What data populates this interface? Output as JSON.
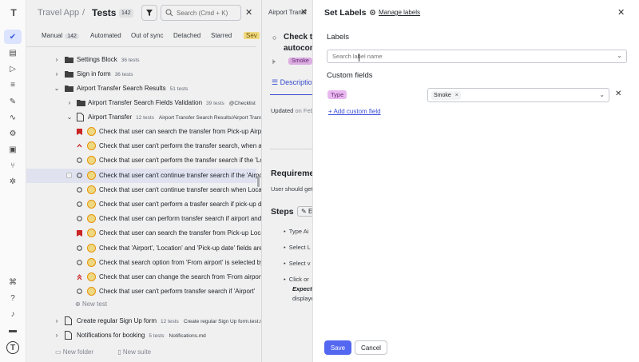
{
  "app": {
    "name": "Travel App",
    "page_title": "Tests",
    "count": "142",
    "search_placeholder": "Search (Cmd + K)"
  },
  "tabs": [
    {
      "label": "Manual",
      "count": "142"
    },
    {
      "label": "Automated"
    },
    {
      "label": "Out of sync"
    },
    {
      "label": "Detached"
    },
    {
      "label": "Starred"
    },
    {
      "label": "Sev"
    }
  ],
  "tree": {
    "settings": {
      "label": "Settings Block",
      "meta": "36 tests"
    },
    "signin": {
      "label": "Sign in form",
      "meta": "36 tests"
    },
    "airport_search": {
      "label": "Airport Transfer Search Results",
      "meta": "51 tests"
    },
    "fields_validation": {
      "label": "Airport Transfer Search Fields Validation",
      "meta": "39 tests",
      "tag": "@Checklist"
    },
    "airport_transfer": {
      "label": "Airport Transfer",
      "meta": "12 tests",
      "path": "Airport Transfer Search Results/Airport Transf"
    },
    "cases": [
      {
        "label": "Check that user can search the transfer from Pick-up Airpo",
        "priority": "high"
      },
      {
        "label": "Check that user can't perform the transfer search, when al",
        "priority": "up"
      },
      {
        "label": "Check that user can't perform the transfer search if the 'Lo",
        "priority": "none"
      },
      {
        "label": "Check that user can't continue transfer search if the 'Airpor",
        "priority": "none"
      },
      {
        "label": "Check that user can't continue transfer search when Locat",
        "priority": "none"
      },
      {
        "label": "Check that user can't perform a trasfer search if pick-up da",
        "priority": "none"
      },
      {
        "label": "Check that user can perform transfer search if airport and",
        "priority": "none"
      },
      {
        "label": "Check that user can search the transfer from Pick-up Loca",
        "priority": "high"
      },
      {
        "label": "Check that 'Airport', 'Location' and 'Pick-up date' fields are",
        "priority": "none"
      },
      {
        "label": "Check that search option from 'From airport' is selected by",
        "priority": "none"
      },
      {
        "label": "Check that user can change the search from 'From airport'",
        "priority": "upup"
      },
      {
        "label": "Check that user can't perform transfer search if 'Airport'",
        "priority": "none"
      }
    ],
    "new_test": "New test",
    "signup": {
      "label": "Create regular Sign Up form",
      "meta": "12 tests",
      "path": "Create regular Sign Up form.test.md"
    },
    "notifications": {
      "label": "Notifications for booking",
      "meta": "5 tests",
      "path": "Notifications.md"
    }
  },
  "footer": {
    "new_folder": "New folder",
    "new_suite": "New suite"
  },
  "middle": {
    "tab": "Airport Transf",
    "heading_line1": "Check th",
    "heading_line2": "autocom",
    "tag": "Smoke",
    "desc_tab": "Descriptio",
    "updated": "Updated",
    "updated_on": "on Feb",
    "req": "Requireme",
    "req_text": "User should get",
    "steps": "Steps",
    "steps_btn": "E",
    "step1": "Type Ai",
    "step2": "Select L",
    "step3": "Select v",
    "step4": "Click or",
    "expected": "Expecte",
    "displayed": "displaye"
  },
  "panel": {
    "title": "Set Labels",
    "manage": "Manage labels",
    "labels_heading": "Labels",
    "labels_placeholder": "Search label name",
    "custom_heading": "Custom fields",
    "field_name": "Type",
    "field_value": "Smoke",
    "add_field": "Add custom field",
    "save": "Save",
    "cancel": "Cancel"
  }
}
